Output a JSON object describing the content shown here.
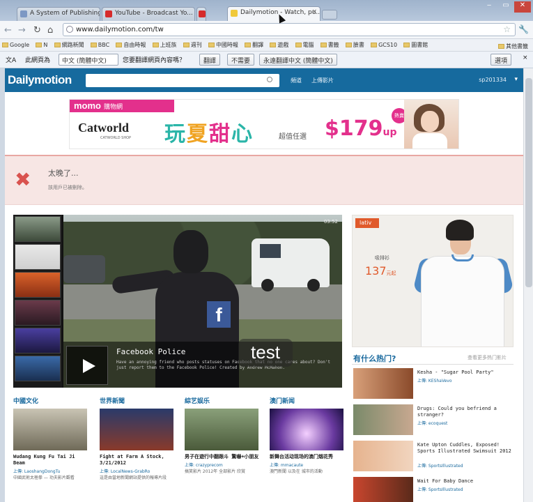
{
  "browser": {
    "tabs": [
      {
        "label": "A System of Publishing g..."
      },
      {
        "label": "YouTube - Broadcast Yo..."
      },
      {
        "label": "Dailymotion - Watch, pu..."
      }
    ],
    "url": "www.dailymotion.com/tw",
    "bookmarks": [
      "Google",
      "N",
      "網路新聞",
      "BBC",
      "自由時報",
      "上班族",
      "週刊",
      "中國時報",
      "翻譯",
      "遊戲",
      "電腦",
      "書籤",
      "臉書",
      "GCS10",
      "圖書館"
    ],
    "other_bookmarks": "其他書籤",
    "translate": {
      "prefix": "此網頁為",
      "language": "中文 (簡體中文)",
      "question": "您要翻譯網頁內容嗎？",
      "translate_button": "翻譯",
      "no_button": "不需要",
      "always_button": "永遠翻譯中文 (簡體中文)",
      "options": "選項"
    }
  },
  "site": {
    "logo": "Dailymotion",
    "nav": [
      "頻道",
      "上傳影片"
    ],
    "user": "sp201334"
  },
  "ad_banner": {
    "brand": "momo",
    "brand_sub": "購物網",
    "catworld": "Catworld",
    "catworld_sub": "CATWORLD SHOP",
    "headline_1": "玩",
    "headline_2": "夏",
    "headline_3": "甜",
    "headline_4": "心",
    "sub": "超值任選",
    "price": "$179",
    "price_suffix": "up",
    "badge": "熱賣"
  },
  "alert": {
    "title": "太晚了...",
    "message": "該用戶已被刪除。"
  },
  "featured": {
    "time": "03:52",
    "title": "Facebook Police",
    "description": "Have an annoying friend who posts statuses on Facebook that no one cares about? Don't just report them to the Facebook Police! Created by Andrew McMahon."
  },
  "side_ad": {
    "brand": "lativ",
    "label": "吸排衫",
    "price": "137",
    "price_unit": "元起"
  },
  "hot": {
    "title": "有什么热门?",
    "more": "查看更多热门影片",
    "items": [
      {
        "title": "Kesha - \"Sugar Pool Party\"",
        "by": "上傳: KEShaVevo"
      },
      {
        "title": "Drugs: Could you befriend a stranger?",
        "by": "上傳: ecoquest"
      },
      {
        "title": "Kate Upton Cuddles, Exposed! Sports Illustrated Swimsuit 2012",
        "by": "上傳: SportsIllustrated"
      },
      {
        "title": "Wait For Baby Dance",
        "by": "上傳: SportsIllustrated"
      }
    ]
  },
  "categories": [
    {
      "head": "中國文化",
      "title": "Wudang Kung Fu Tai Ji Beam",
      "by": "上傳: LaoshangDongTu",
      "desc": "中國武術太極拳 — 功夫影片觀看"
    },
    {
      "head": "世界新聞",
      "title": "Fight at Farm A Stock, 3/21/2012",
      "by": "上傳: LocalNews-GrabRo",
      "desc": "這是由當地新聞網站提供的報導片段"
    },
    {
      "head": "綜艺娱乐",
      "title": "男子在遊行中翻跟斗 驚嚇+小朋友",
      "by": "上傳: crazyprecom",
      "desc": "搞笑影片 2012年 全部影片 欣賞"
    },
    {
      "head": "澳门新闻",
      "title": "新舞台活动现场的澳门烟花秀",
      "by": "上傳: mmacaute",
      "desc": "澳門新聞 以及在 城市的活動"
    }
  ],
  "overlay": {
    "text": "test"
  }
}
